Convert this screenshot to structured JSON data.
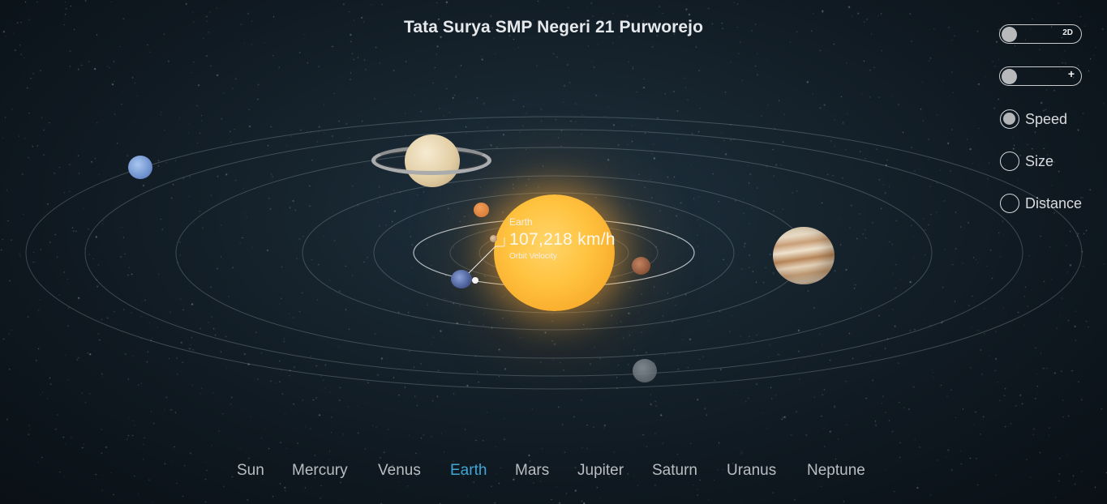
{
  "title": "Tata Surya SMP Negeri 21 Purworejo",
  "controls": {
    "view_toggle": {
      "label": "2D",
      "on": false
    },
    "zoom_toggle": {
      "label": "+",
      "on": false
    },
    "modes": [
      {
        "label": "Speed",
        "selected": true
      },
      {
        "label": "Size",
        "selected": false
      },
      {
        "label": "Distance",
        "selected": false
      }
    ]
  },
  "focus_info": {
    "planet": "Earth",
    "value": "107,218 km/h",
    "caption": "Orbit Velocity"
  },
  "nav": {
    "active": "Earth",
    "items": [
      "Sun",
      "Mercury",
      "Venus",
      "Earth",
      "Mars",
      "Jupiter",
      "Saturn",
      "Uranus",
      "Neptune"
    ]
  },
  "colors": {
    "accent": "#3fa8d6",
    "sun": "#ffc23e",
    "background": "#101a22"
  }
}
